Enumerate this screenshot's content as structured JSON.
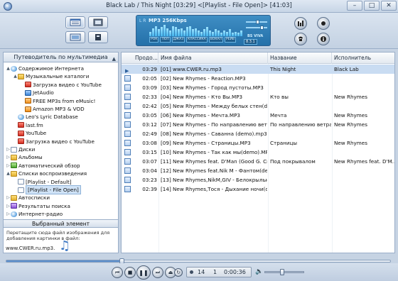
{
  "window": {
    "title": "Black Lab / This Night  [03:29]   <[Playlist - File Open]>  [41:03]",
    "minimize_label": "–",
    "maximize_label": "□",
    "close_label": "✕"
  },
  "visualizer": {
    "channel_label": "L R",
    "format": "MP3 256Kbps",
    "genres": [
      "РОК",
      "ПОП",
      "ДЖАЗ",
      "КЛАССИКА",
      "ВОКАЛ",
      "РЕЙВ"
    ],
    "version": "8.3.1",
    "brand": "BS VIVA",
    "spectrum_levels": [
      0.4,
      0.7,
      0.9,
      0.6,
      0.8,
      1.0,
      0.7,
      0.5,
      0.9,
      0.8,
      0.6,
      0.7,
      0.5,
      0.8,
      0.9,
      0.6,
      0.7,
      0.5,
      0.4,
      0.6,
      0.8,
      0.5,
      0.4,
      0.6,
      0.5,
      0.3,
      0.5,
      0.4,
      0.6,
      0.3,
      0.4,
      0.3,
      0.5
    ]
  },
  "left_panel": {
    "header": "Путеводитель по мультимедиа",
    "tree": [
      {
        "label": "Содержимое Интернета",
        "icon": "globe",
        "level": 0,
        "exp": "▲"
      },
      {
        "label": "Музыкальные каталоги",
        "icon": "folder",
        "level": 1,
        "exp": "▲"
      },
      {
        "label": "Загрузка видео с YouTube",
        "icon": "red",
        "level": 2,
        "exp": ""
      },
      {
        "label": "JetAudio",
        "icon": "blue",
        "level": 2,
        "exp": ""
      },
      {
        "label": "FREE MP3s from eMusic!",
        "icon": "orange",
        "level": 2,
        "exp": ""
      },
      {
        "label": "Amazon MP3 & VOD",
        "icon": "orange",
        "level": 2,
        "exp": ""
      },
      {
        "label": "Leo's Lyric Database",
        "icon": "globe",
        "level": 1,
        "exp": ""
      },
      {
        "label": "last.fm",
        "icon": "red",
        "level": 1,
        "exp": ""
      },
      {
        "label": "YouTube",
        "icon": "red",
        "level": 1,
        "exp": ""
      },
      {
        "label": "Загрузка видео с YouTube",
        "icon": "red",
        "level": 1,
        "exp": ""
      },
      {
        "label": "Диски",
        "icon": "doc",
        "level": 0,
        "exp": "▷"
      },
      {
        "label": "Альбомы",
        "icon": "folder",
        "level": 0,
        "exp": "▷"
      },
      {
        "label": "Автоматический обзор",
        "icon": "green",
        "level": 0,
        "exp": "▷"
      },
      {
        "label": "Списки воспроизведения",
        "icon": "folder",
        "level": 0,
        "exp": "▲"
      },
      {
        "label": "[Playlist - Default]",
        "icon": "doc",
        "level": 1,
        "exp": ""
      },
      {
        "label": "[Playlist - File Open]",
        "icon": "doc",
        "level": 1,
        "exp": "",
        "selected": true
      },
      {
        "label": "Автосписки",
        "icon": "folder",
        "level": 0,
        "exp": "▷"
      },
      {
        "label": "Результаты поиска",
        "icon": "purple",
        "level": 0,
        "exp": "▷"
      },
      {
        "label": "Интернет-радио",
        "icon": "globe",
        "level": 0,
        "exp": "▷"
      }
    ],
    "selected_header": "Выбранный элемент",
    "drop_hint": "Перетащите сюда файл изображения для добавления картинки в файл:",
    "selected_file": "www.CWER.ru.mp3."
  },
  "playlist": {
    "columns": [
      "Продо...",
      "Имя файла",
      "Название",
      "Исполнитель"
    ],
    "rows": [
      {
        "duration": "03:29",
        "file": "[01] www.CWER.ru.mp3",
        "title": "This Night",
        "artist": "Black Lab",
        "playing": true
      },
      {
        "duration": "02:05",
        "file": "[02] New Rhymes - Reaction.MP3",
        "title": "",
        "artist": ""
      },
      {
        "duration": "03:09",
        "file": "[03] New Rhymes - Город пустоты.MP3",
        "title": "",
        "artist": ""
      },
      {
        "duration": "02:33",
        "file": "[04] New Rhymes - Кто Вы.MP3",
        "title": "Кто вы",
        "artist": "New Rhymes"
      },
      {
        "duration": "02:42",
        "file": "[05] New Rhymes - Между белых стен(de...",
        "title": "",
        "artist": ""
      },
      {
        "duration": "03:05",
        "file": "[06] New Rhymes - Мечта.MP3",
        "title": "Мечта",
        "artist": "New Rhymes"
      },
      {
        "duration": "03:12",
        "file": "[07] New Rhymes - По направлению ветра...",
        "title": "По направлению ветра",
        "artist": "New Rhymes"
      },
      {
        "duration": "02:49",
        "file": "[08] New Rhymes - Саванна (demo).mp3",
        "title": "",
        "artist": ""
      },
      {
        "duration": "03:08",
        "file": "[09] New Rhymes - Страницы.MP3",
        "title": "Страницы",
        "artist": "New Rhymes"
      },
      {
        "duration": "03:15",
        "file": "[10] New Rhymes - Так как мы(demo).MP3",
        "title": "",
        "artist": ""
      },
      {
        "duration": "03:07",
        "file": "[11] New Rhymes feat. D'Man (Good G. Cr...",
        "title": "Под покрывалом",
        "artist": "New Rhymes feat. D'M..."
      },
      {
        "duration": "03:04",
        "file": "[12] New Rhymes feat.Nik M - Фантом(dem...",
        "title": "",
        "artist": ""
      },
      {
        "duration": "03:23",
        "file": "[13] New Rhymes,NikM,GIV - Белокрылые...",
        "title": "",
        "artist": ""
      },
      {
        "duration": "02:39",
        "file": "[14] New Rhymes,Тося - Дыхание ночи(d...",
        "title": "",
        "artist": ""
      }
    ]
  },
  "player": {
    "progress": 0.3,
    "volume": 0.45,
    "track_number": "14",
    "current_index": "1",
    "time": "0:00:36"
  }
}
